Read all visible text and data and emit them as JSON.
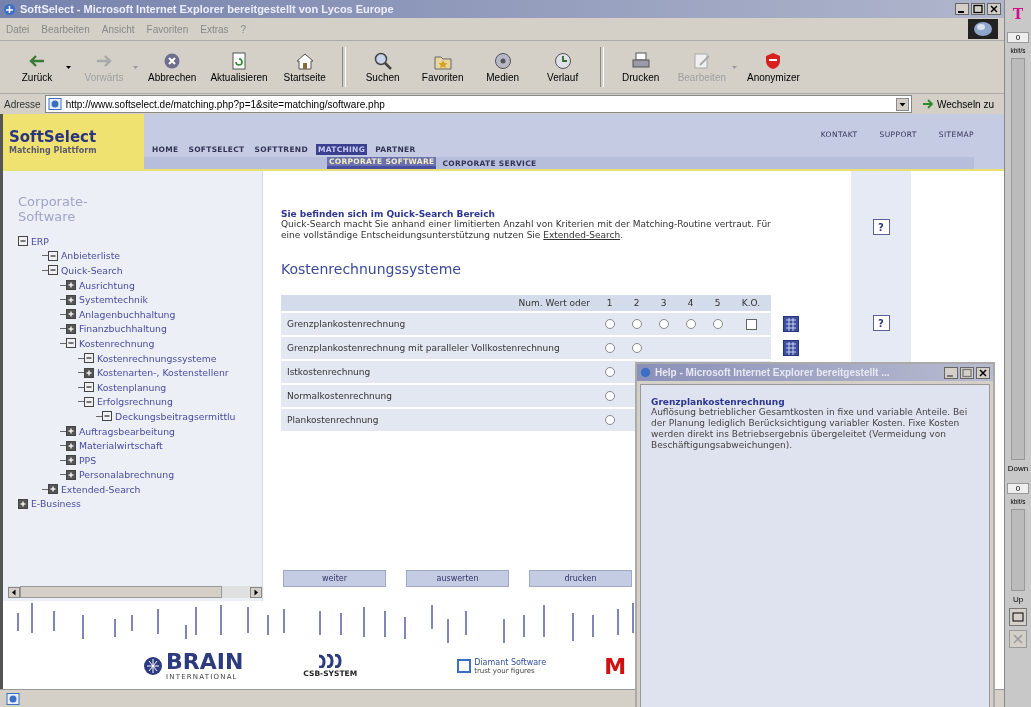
{
  "window": {
    "title": "SoftSelect - Microsoft Internet Explorer bereitgestellt von Lycos Europe"
  },
  "menu": [
    "Datei",
    "Bearbeiten",
    "Ansicht",
    "Favoriten",
    "Extras",
    "?"
  ],
  "toolbar": [
    [
      {
        "label": "Zurück",
        "kind": "back",
        "disabled": false,
        "dropdown": true
      },
      {
        "label": "Vorwärts",
        "kind": "forward",
        "disabled": true,
        "dropdown": true
      },
      {
        "label": "Abbrechen",
        "kind": "stop",
        "disabled": false,
        "dropdown": false
      },
      {
        "label": "Aktualisieren",
        "kind": "refresh",
        "disabled": false,
        "dropdown": false
      },
      {
        "label": "Startseite",
        "kind": "home",
        "disabled": false,
        "dropdown": false
      }
    ],
    [
      {
        "label": "Suchen",
        "kind": "search",
        "disabled": false,
        "dropdown": false
      },
      {
        "label": "Favoriten",
        "kind": "favorites",
        "disabled": false,
        "dropdown": false
      },
      {
        "label": "Medien",
        "kind": "media",
        "disabled": false,
        "dropdown": false
      },
      {
        "label": "Verlauf",
        "kind": "history",
        "disabled": false,
        "dropdown": false
      }
    ],
    [
      {
        "label": "Drucken",
        "kind": "print",
        "disabled": false,
        "dropdown": false
      },
      {
        "label": "Bearbeiten",
        "kind": "edit",
        "disabled": true,
        "dropdown": true
      },
      {
        "label": "Anonymizer",
        "kind": "shield",
        "disabled": false,
        "dropdown": false
      }
    ]
  ],
  "address": {
    "label": "Adresse",
    "value": "http://www.softselect.de/matching.php?p=1&site=matching/software.php",
    "go": "Wechseln zu"
  },
  "site": {
    "logo": "SoftSelect",
    "subtitle": "Matching Plattform",
    "nav": [
      {
        "label": "HOME",
        "selected": false
      },
      {
        "label": "SOFTSELECT",
        "selected": false
      },
      {
        "label": "SOFTTREND",
        "selected": false
      },
      {
        "label": "MATCHING",
        "selected": true
      },
      {
        "label": "PARTNER",
        "selected": false
      }
    ],
    "subnav": [
      {
        "label": "CORPORATE SOFTWARE",
        "selected": true
      },
      {
        "label": "CORPORATE SERVICE",
        "selected": false
      }
    ],
    "utility": [
      "KONTAKT",
      "SUPPORT",
      "SITEMAP"
    ]
  },
  "sidebar": {
    "title": [
      "Corporate-",
      "Software"
    ],
    "tree": [
      {
        "label": "ERP",
        "expanded": true,
        "children": [
          {
            "label": "Anbieterliste",
            "expanded": true
          },
          {
            "label": "Quick-Search",
            "expanded": true,
            "children": [
              {
                "label": "Ausrichtung",
                "expanded": false
              },
              {
                "label": "Systemtechnik",
                "expanded": false
              },
              {
                "label": "Anlagenbuchhaltung",
                "expanded": false
              },
              {
                "label": "Finanzbuchhaltung",
                "expanded": false
              },
              {
                "label": "Kostenrechnung",
                "expanded": true,
                "children": [
                  {
                    "label": "Kostenrechnungssysteme",
                    "expanded": true
                  },
                  {
                    "label": "Kostenarten-, Kostenstellenr",
                    "expanded": false
                  },
                  {
                    "label": "Kostenplanung",
                    "expanded": true
                  },
                  {
                    "label": "Erfolgsrechnung",
                    "expanded": true,
                    "children": [
                      {
                        "label": "Deckungsbeitragsermittlu",
                        "expanded": true
                      }
                    ]
                  }
                ]
              },
              {
                "label": "Auftragsbearbeitung",
                "expanded": false
              },
              {
                "label": "Materialwirtschaft",
                "expanded": false
              },
              {
                "label": "PPS",
                "expanded": false
              },
              {
                "label": "Personalabrechnung",
                "expanded": false
              }
            ]
          },
          {
            "label": "Extended-Search",
            "expanded": false
          }
        ]
      },
      {
        "label": "E-Business",
        "expanded": false
      }
    ]
  },
  "intro": {
    "heading": "Sie befinden sich im Quick-Search Bereich",
    "text": "Quick-Search macht Sie anhand einer limitierten Anzahl von Kriterien mit der Matching-Routine vertraut. Für eine vollständige Entscheidungsunterstützung nutzen Sie ",
    "link": "Extended-Search",
    "end": ".",
    "help": "?"
  },
  "section_title": "Kostenrechnungssysteme",
  "table": {
    "header": "Num. Wert oder",
    "columns": [
      "1",
      "2",
      "3",
      "4",
      "5",
      "K.O."
    ],
    "rows": [
      {
        "label": "Grenzplankostenrechnung",
        "options": [
          {
            "selected": false
          },
          {
            "selected": false
          },
          {
            "selected": false
          },
          {
            "selected": false
          },
          {
            "selected": false
          }
        ],
        "ko": {
          "checked": false
        },
        "list_icon": true,
        "help": "?"
      },
      {
        "label": "Grenzplankostenrechnung mit paralleler Vollkostenrechnung",
        "options": [
          {
            "selected": false
          },
          {
            "selected": false
          }
        ],
        "list_icon": true
      },
      {
        "label": "Istkostenrechnung",
        "options": [
          {
            "selected": false
          }
        ]
      },
      {
        "label": "Normalkostenrechnung",
        "options": [
          {
            "selected": false
          }
        ]
      },
      {
        "label": "Plankostenrechnung",
        "options": [
          {
            "selected": false
          }
        ]
      }
    ]
  },
  "buttons": [
    "weiter",
    "auswerten",
    "drucken"
  ],
  "logos": {
    "brain": "BRAIN",
    "brain_sub": "INTERNATIONAL",
    "csb": "CSB-SYSTEM",
    "diamant": "Diamant Software",
    "diamant_sub": "trust your figures",
    "cut": "M"
  },
  "popup": {
    "title": "Help - Microsoft Internet Explorer bereitgestellt ...",
    "heading": "Grenzplankostenrechnung",
    "text": "Auflösung betrieblicher Gesamtkosten in fixe und variable Anteile. Bei der Planung lediglich Berücksichtigung variabler Kosten. Fixe Kosten werden direkt ins Betriebsergebnis übergeleitet (Vermeidung von Beschäftigungsabweichungen)."
  },
  "monitor": {
    "logo": "T",
    "down_value": "0",
    "down_unit": "kbit/s",
    "down_label": "Down",
    "up_value": "0",
    "up_unit": "kbit/s",
    "up_label": "Up"
  }
}
